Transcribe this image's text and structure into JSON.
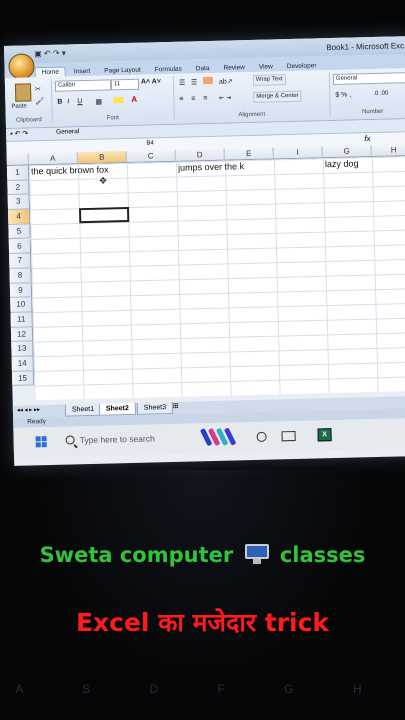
{
  "window": {
    "title": "Book1 - Microsoft Exc"
  },
  "ribbon": {
    "tabs": [
      "Home",
      "Insert",
      "Page Layout",
      "Formulas",
      "Data",
      "Review",
      "View",
      "Developer"
    ],
    "active_tab": "Home",
    "font_name": "Calibri",
    "font_size": "11",
    "wrap_text": "Wrap Text",
    "merge_center": "Merge & Center",
    "number_format": "General",
    "groups": {
      "clipboard": "Clipboard",
      "font": "Font",
      "alignment": "Alignment",
      "number": "Number"
    },
    "paste": "Paste"
  },
  "toolbar2": {
    "format": "General"
  },
  "formula_bar": {
    "name_box": "B4",
    "fx": "fx"
  },
  "grid": {
    "columns": [
      "A",
      "B",
      "C",
      "D",
      "E",
      "I",
      "G",
      "H"
    ],
    "rows": [
      "1",
      "2",
      "3",
      "4",
      "5",
      "6",
      "7",
      "8",
      "9",
      "10",
      "11",
      "12",
      "13",
      "14",
      "15"
    ],
    "selected_column": "B",
    "selected_row": "4",
    "cells": {
      "A1": "the quick brown fox",
      "D1": "jumps over the k",
      "G1": "lazy dog"
    }
  },
  "sheets": [
    "Sheet1",
    "Sheet2",
    "Sheet3"
  ],
  "active_sheet": "Sheet2",
  "status": "Ready",
  "taskbar": {
    "search_placeholder": "Type here to search"
  },
  "captions": {
    "line1_a": "Sweta computer",
    "line1_b": "classes",
    "line2": "Excel का मजेदार trick"
  },
  "keyboard": "A S D F G H",
  "colors": {
    "caption_green": "#33c33a",
    "caption_red": "#ff1b1b",
    "excel_green": "#1d6f42",
    "selection": "#f3c477"
  }
}
